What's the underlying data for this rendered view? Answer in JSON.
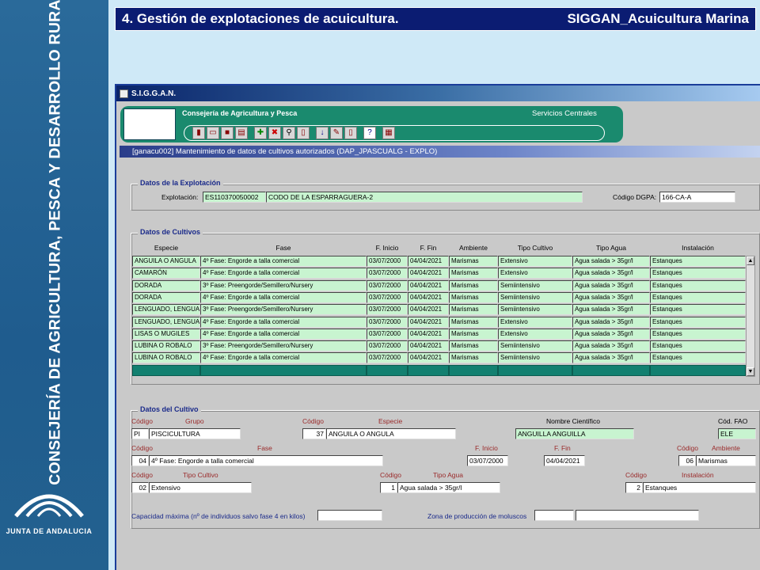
{
  "slide": {
    "title_left": "4. Gestión de explotaciones de acuicultura.",
    "title_right": "SIGGAN_Acuicultura Marina",
    "sidebar_text": "CONSEJERÍA DE AGRICULTURA, PESCA Y DESARROLLO RURAL",
    "logo_text": "JUNTA DE ANDALUCIA"
  },
  "app": {
    "window_title": "S.I.G.G.A.N.",
    "banner_left": "Consejería de Agricultura y Pesca",
    "banner_right": "Servicios Centrales",
    "form_title": "[ganacu002] Mantenimiento de datos de cultivos autorizados   (DAP_JPASCUALG - EXPLO)",
    "toolbar_icons": [
      "door-icon",
      "open-folder-icon",
      "save-icon",
      "print-icon",
      "add-icon",
      "delete-icon",
      "find-icon",
      "doc-icon",
      "download-icon",
      "edit-icon",
      "page-icon",
      "help-icon",
      "grid-icon"
    ]
  },
  "explotacion": {
    "section": "Datos de la Explotación",
    "label": "Explotación:",
    "code": "ES110370050002",
    "name": "CODO DE LA ESPARRAGUERA-2",
    "dgpa_label": "Código DGPA:",
    "dgpa": "166-CA-A"
  },
  "cultivos": {
    "section": "Datos de Cultivos",
    "headers": [
      "Especie",
      "Fase",
      "F. Inicio",
      "F. Fin",
      "Ambiente",
      "Tipo Cultivo",
      "Tipo Agua",
      "Instalación"
    ],
    "rows": [
      [
        "ANGUILA O ANGULA",
        "4º Fase: Engorde a talla comercial",
        "03/07/2000",
        "04/04/2021",
        "Marismas",
        "Extensivo",
        "Agua salada > 35gr/l",
        "Estanques"
      ],
      [
        "CAMARÓN",
        "4º Fase: Engorde a talla comercial",
        "03/07/2000",
        "04/04/2021",
        "Marismas",
        "Extensivo",
        "Agua salada > 35gr/l",
        "Estanques"
      ],
      [
        "DORADA",
        "3º Fase: Preengorde/Semillero/Nursery",
        "03/07/2000",
        "04/04/2021",
        "Marismas",
        "Semiintensivo",
        "Agua salada > 35gr/l",
        "Estanques"
      ],
      [
        "DORADA",
        "4º Fase: Engorde a talla comercial",
        "03/07/2000",
        "04/04/2021",
        "Marismas",
        "Semiintensivo",
        "Agua salada > 35gr/l",
        "Estanques"
      ],
      [
        "LENGUADO, LENGUA",
        "3º Fase: Preengorde/Semillero/Nursery",
        "03/07/2000",
        "04/04/2021",
        "Marismas",
        "Semiintensivo",
        "Agua salada > 35gr/l",
        "Estanques"
      ],
      [
        "LENGUADO, LENGUA",
        "4º Fase: Engorde a talla comercial",
        "03/07/2000",
        "04/04/2021",
        "Marismas",
        "Extensivo",
        "Agua salada > 35gr/l",
        "Estanques"
      ],
      [
        "LISAS O MUGILES",
        "4º Fase: Engorde a talla comercial",
        "03/07/2000",
        "04/04/2021",
        "Marismas",
        "Extensivo",
        "Agua salada > 35gr/l",
        "Estanques"
      ],
      [
        "LUBINA O ROBALO",
        "3º Fase: Preengorde/Semillero/Nursery",
        "03/07/2000",
        "04/04/2021",
        "Marismas",
        "Semiintensivo",
        "Agua salada > 35gr/l",
        "Estanques"
      ],
      [
        "LUBINA O ROBALO",
        "4º Fase: Engorde a talla comercial",
        "03/07/2000",
        "04/04/2021",
        "Marismas",
        "Semiintensivo",
        "Agua salada > 35gr/l",
        "Estanques"
      ]
    ]
  },
  "detalle": {
    "section": "Datos del Cultivo",
    "l_codigo": "Código",
    "l_grupo": "Grupo",
    "l_especie": "Especie",
    "l_nombre": "Nombre Científico",
    "l_fao": "Cód. FAO",
    "l_fase": "Fase",
    "l_finicio": "F. Inicio",
    "l_ffin": "F. Fin",
    "l_ambiente": "Ambiente",
    "l_tipocultivo": "Tipo Cultivo",
    "l_tipoagua": "Tipo Agua",
    "l_instalacion": "Instalación",
    "grupo_code": "PI",
    "grupo": "PISCICULTURA",
    "especie_code": "37",
    "especie": "ANGUILA O ANGULA",
    "nombre_cientifico": "ANGUILLA ANGUILLA",
    "fao": "ELE",
    "fase_code": "04",
    "fase": "4º Fase: Engorde a talla comercial",
    "finicio": "03/07/2000",
    "ffin": "04/04/2021",
    "ambiente_code": "06",
    "ambiente": "Marismas",
    "tipocultivo_code": "02",
    "tipocultivo": "Extensivo",
    "tipoagua_code": "1",
    "tipoagua": "Agua salada > 35gr/l",
    "instalacion_code": "2",
    "instalacion": "Estanques",
    "l_capacidad": "Capacidad máxima (nº de individuos salvo fase 4 en kilos)",
    "l_zona": "Zona de producción de moluscos"
  }
}
